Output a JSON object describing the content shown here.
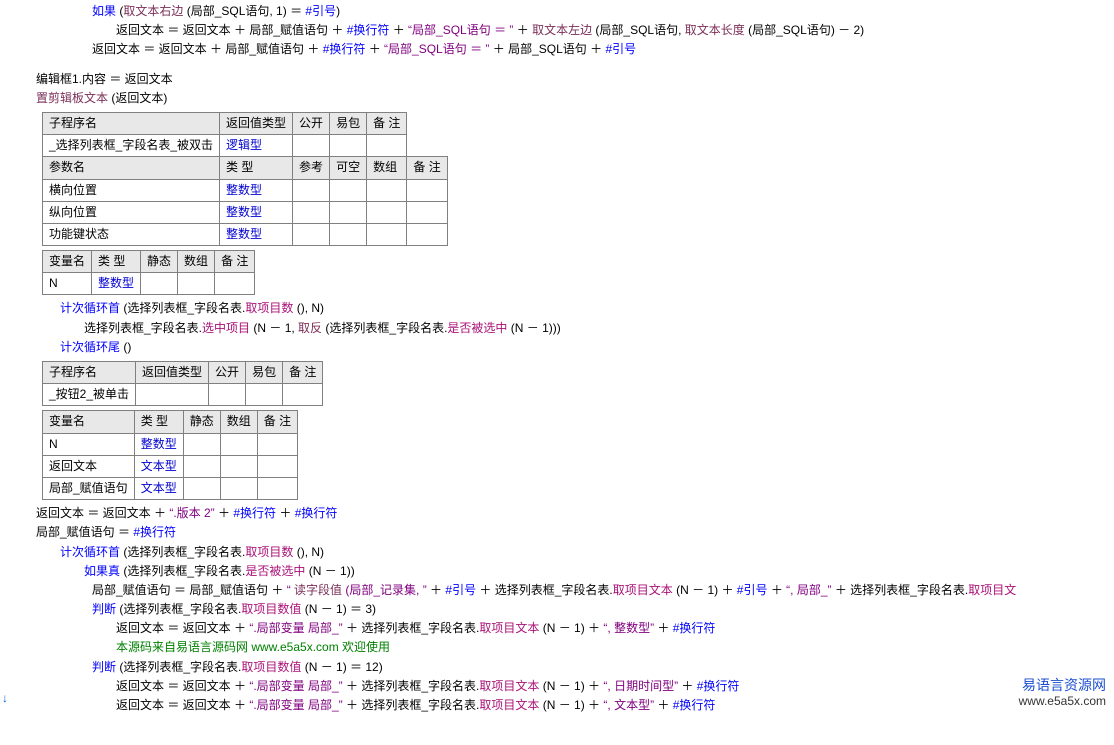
{
  "topcode": {
    "l1a": "如果",
    "l1b": " (",
    "l1fn": "取文本右边",
    "l1c": " (局部_SQL语句, 1) ＝ ",
    "l1d": "#引号",
    "l1e": ")",
    "l2a": "返回文本 ＝ 返回文本 ＋ 局部_赋值语句 ＋ ",
    "l2b": "#换行符",
    "l2c": " ＋ ",
    "l2s": "“局部_SQL语句 ＝ ”",
    "l2d": " ＋ ",
    "l2fn": "取文本左边",
    "l2e": " (局部_SQL语句, ",
    "l2fn2": "取文本长度",
    "l2f": " (局部_SQL语句) － 2)",
    "l3a": "返回文本 ＝ 返回文本 ＋ 局部_赋值语句 ＋ ",
    "l3b": "#换行符",
    "l3c": " ＋ ",
    "l3s": "“局部_SQL语句 ＝ ”",
    "l3d": " ＋ 局部_SQL语句 ＋ ",
    "l3e": "#引号",
    "l4": "编辑框1.内容 ＝ 返回文本",
    "l5a": "置剪辑板文本",
    "l5b": " (返回文本)"
  },
  "table1": {
    "h": [
      "子程序名",
      "返回值类型",
      "公开",
      "易包",
      "备 注"
    ],
    "r1": [
      "_选择列表框_字段名表_被双击",
      "逻辑型",
      "",
      "",
      ""
    ],
    "h2": [
      "参数名",
      "类 型",
      "参考",
      "可空",
      "数组",
      "备 注"
    ],
    "rows": [
      [
        "横向位置",
        "整数型",
        "",
        "",
        "",
        ""
      ],
      [
        "纵向位置",
        "整数型",
        "",
        "",
        "",
        ""
      ],
      [
        "功能键状态",
        "整数型",
        "",
        "",
        "",
        ""
      ]
    ]
  },
  "table2": {
    "h": [
      "变量名",
      "类 型",
      "静态",
      "数组",
      "备 注"
    ],
    "rows": [
      [
        "N",
        "整数型",
        "",
        "",
        ""
      ]
    ]
  },
  "midcode": {
    "a1": "计次循环首",
    "a1b": " (选择列表框_字段名表.",
    "a1c": "取项目数",
    "a1d": " (), N)",
    "b1": "选择列表框_字段名表.",
    "b2": "选中项目",
    "b3": " (N － 1, ",
    "b4": "取反",
    "b5": " (选择列表框_字段名表.",
    "b6": "是否被选中",
    "b7": " (N － 1)))",
    "c1": "计次循环尾",
    "c1b": " ()"
  },
  "table3": {
    "h": [
      "子程序名",
      "返回值类型",
      "公开",
      "易包",
      "备 注"
    ],
    "rows": [
      [
        "_按钮2_被单击",
        "",
        "",
        "",
        ""
      ]
    ]
  },
  "table4": {
    "h": [
      "变量名",
      "类 型",
      "静态",
      "数组",
      "备 注"
    ],
    "rows": [
      [
        "N",
        "整数型",
        "",
        "",
        ""
      ],
      [
        "返回文本",
        "文本型",
        "",
        "",
        ""
      ],
      [
        "局部_赋值语句",
        "文本型",
        "",
        "",
        ""
      ]
    ]
  },
  "bottomcode": {
    "l1": "返回文本 ＝ 返回文本 ＋ ",
    "l1s": "“.版本 2”",
    "l1b": " ＋ ",
    "l1c": "#换行符",
    "l1d": " ＋ ",
    "l1e": "#换行符",
    "l2": "局部_赋值语句 ＝ ",
    "l2b": "#换行符",
    "l3a": "计次循环首",
    "l3b": " (选择列表框_字段名表.",
    "l3c": "取项目数",
    "l3d": " (), N)",
    "l4a": "如果真",
    "l4b": " (选择列表框_字段名表.",
    "l4c": "是否被选中",
    "l4d": " (N － 1))",
    "l5a": "局部_赋值语句 ＝ 局部_赋值语句 ＋ ",
    "l5s": "“    ",
    "l5fn": "读字段值",
    "l5s2": "  (局部_记录集, ”",
    "l5b": " ＋ ",
    "l5c": "#引号",
    "l5d": " ＋ 选择列表框_字段名表.",
    "l5e": "取项目文本",
    "l5f": " (N － 1) ＋ ",
    "l5g": "#引号",
    "l5h": " ＋ ",
    "l5s3": "“, 局部_”",
    "l5i": " ＋ 选择列表框_字段名表.",
    "l5j": "取项目文",
    "l6a": "判断",
    "l6b": " (选择列表框_字段名表.",
    "l6c": "取项目数值",
    "l6d": " (N － 1) ＝ 3)",
    "l7a": "返回文本 ＝ 返回文本 ＋ ",
    "l7s": "“.局部变量 局部_”",
    "l7b": " ＋ 选择列表框_字段名表.",
    "l7c": "取项目文本",
    "l7d": " (N － 1) ＋ ",
    "l7s2": "“, 整数型”",
    "l7e": " ＋ ",
    "l7f": "#换行符",
    "l8": "本源码来自易语言源码网 www.e5a5x.com  欢迎使用",
    "l9a": "判断",
    "l9b": " (选择列表框_字段名表.",
    "l9c": "取项目数值",
    "l9d": " (N － 1) ＝ 12)",
    "l10a": "返回文本 ＝ 返回文本 ＋ ",
    "l10s": "“.局部变量 局部_”",
    "l10b": " ＋ 选择列表框_字段名表.",
    "l10c": "取项目文本",
    "l10d": " (N － 1) ＋ ",
    "l10s2": "“, 日期时间型”",
    "l10e": " ＋ ",
    "l10f": "#换行符",
    "l11a": "返回文本 ＝ 返回文本 ＋ ",
    "l11s": "“.局部变量 局部_”",
    "l11b": " ＋ 选择列表框_字段名表.",
    "l11c": "取项目文本",
    "l11d": " (N － 1) ＋ ",
    "l11s2": "“, 文本型”",
    "l11e": " ＋ ",
    "l11f": "#换行符"
  },
  "footer": {
    "title": "易语言资源网",
    "url": "www.e5a5x.com"
  },
  "arrow": "↓"
}
